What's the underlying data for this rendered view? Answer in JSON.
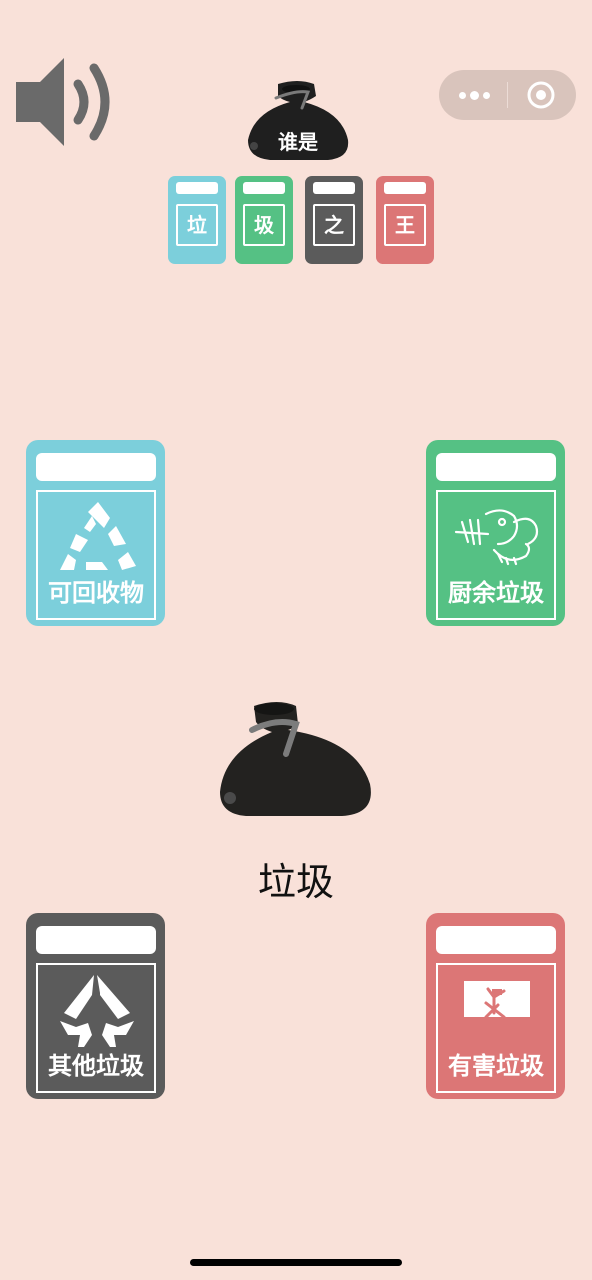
{
  "title": {
    "text": "谁是"
  },
  "mini_bins": [
    {
      "char": "垃",
      "color": "#7ccfdb"
    },
    {
      "char": "圾",
      "color": "#55c184"
    },
    {
      "char": "之",
      "color": "#5b5b5b"
    },
    {
      "char": "王",
      "color": "#dc7676"
    }
  ],
  "bins": {
    "recyclable": {
      "label": "可回收物",
      "color": "#7ccfdb",
      "icon": "recycle-icon"
    },
    "kitchen": {
      "label": "厨余垃圾",
      "color": "#55c184",
      "icon": "fishbone-icon"
    },
    "other": {
      "label": "其他垃圾",
      "color": "#5b5b5b",
      "icon": "other-waste-icon"
    },
    "hazardous": {
      "label": "有害垃圾",
      "color": "#dc7676",
      "icon": "hazardous-icon"
    }
  },
  "current_item": {
    "name": "垃圾",
    "icon": "garbage-bag-icon"
  },
  "toolbar": {
    "sound_icon": "speaker-icon",
    "more_icon": "more-dots-icon",
    "close_icon": "target-circle-icon"
  }
}
